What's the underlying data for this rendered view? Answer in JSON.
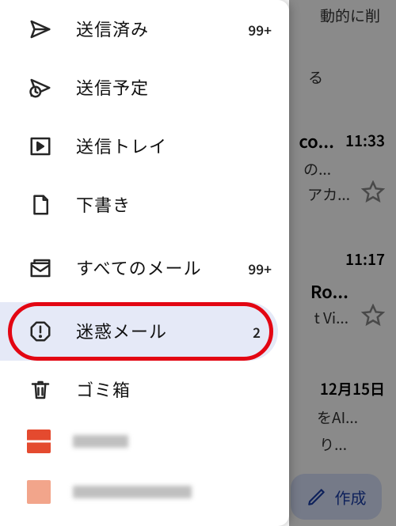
{
  "drawer": {
    "items": [
      {
        "key": "sent",
        "label": "送信済み",
        "count": "99+"
      },
      {
        "key": "scheduled",
        "label": "送信予定",
        "count": ""
      },
      {
        "key": "outbox",
        "label": "送信トレイ",
        "count": ""
      },
      {
        "key": "drafts",
        "label": "下書き",
        "count": ""
      },
      {
        "key": "allmail",
        "label": "すべてのメール",
        "count": "99+"
      },
      {
        "key": "spam",
        "label": "迷惑メール",
        "count": "2"
      },
      {
        "key": "trash",
        "label": "ゴミ箱",
        "count": ""
      }
    ]
  },
  "background": {
    "line0a": "動的に削",
    "line0b": "る",
    "row1_sender": "co...",
    "row1_time": "11:33",
    "row1_line1": "の...",
    "row1_line2": "アカ...",
    "row2_time": "11:17",
    "row2_sender": "Ro...",
    "row2_line1": "t Vi...",
    "row3_date": "12月15日",
    "row3_line1": "をAI...",
    "row3_line2": "り...",
    "compose": "作成"
  }
}
